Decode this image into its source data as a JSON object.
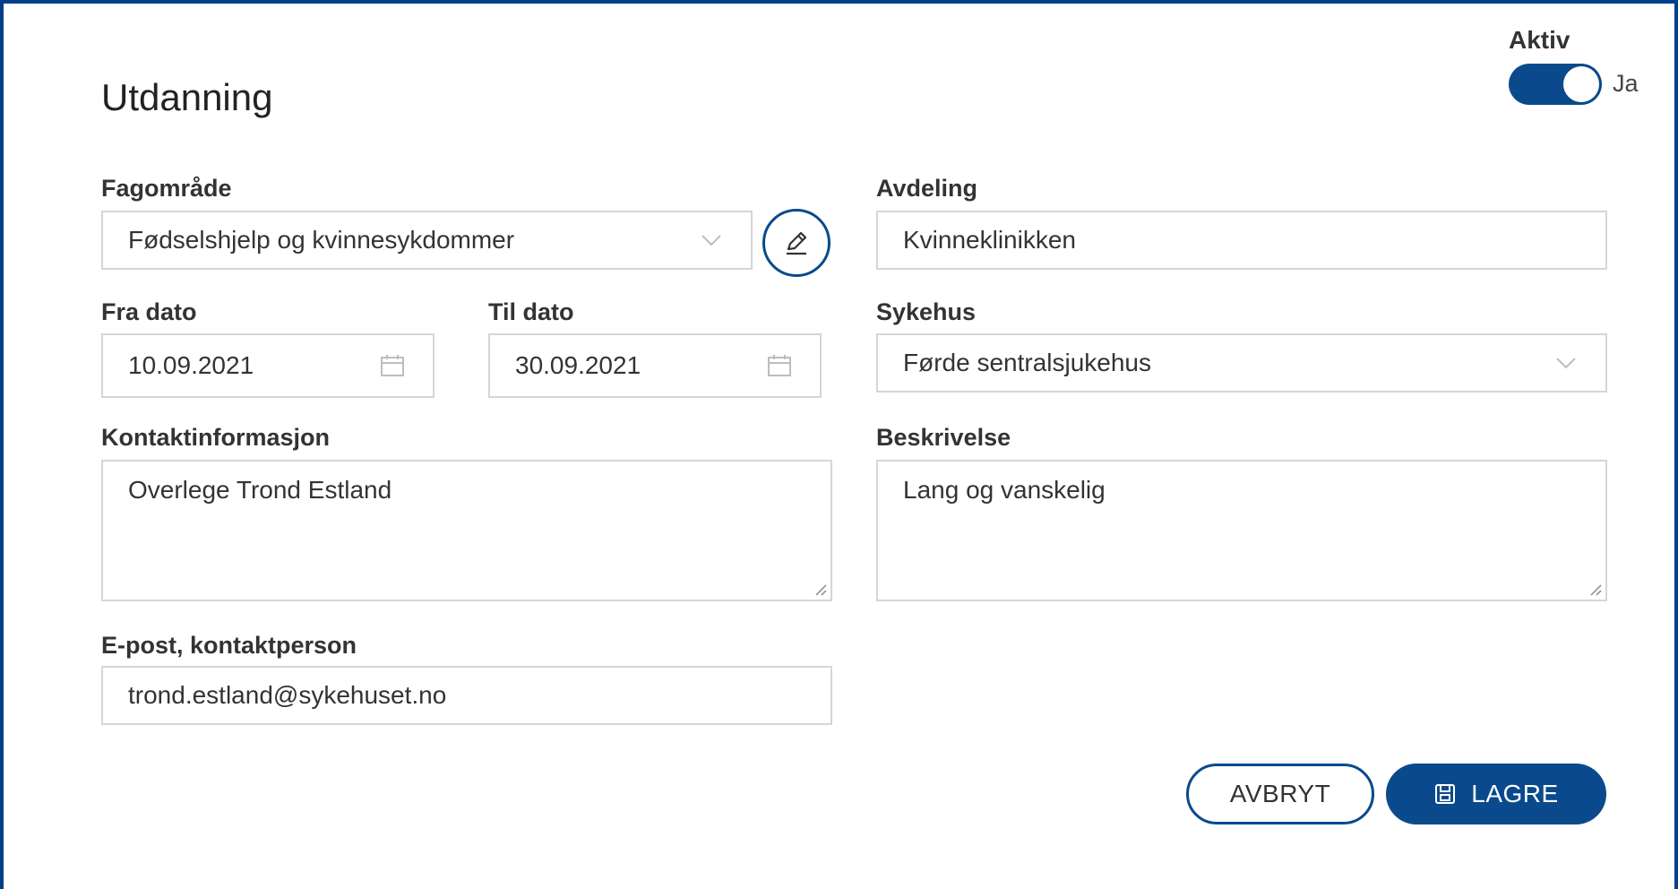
{
  "title": "Utdanning",
  "active_toggle": {
    "label": "Aktiv",
    "state_text": "Ja",
    "on": true
  },
  "fields": {
    "fagomrade": {
      "label": "Fagområde",
      "value": "Fødselshjelp og kvinnesykdommer"
    },
    "avdeling": {
      "label": "Avdeling",
      "value": "Kvinneklinikken"
    },
    "fra_dato": {
      "label": "Fra dato",
      "value": "10.09.2021"
    },
    "til_dato": {
      "label": "Til dato",
      "value": "30.09.2021"
    },
    "sykehus": {
      "label": "Sykehus",
      "value": "Førde sentralsjukehus"
    },
    "kontaktinformasjon": {
      "label": "Kontaktinformasjon",
      "value": "Overlege Trond Estland"
    },
    "beskrivelse": {
      "label": "Beskrivelse",
      "value": "Lang og vanskelig"
    },
    "epost": {
      "label": "E-post, kontaktperson",
      "value": "trond.estland@sykehuset.no"
    }
  },
  "buttons": {
    "cancel": "AVBRYT",
    "save": "LAGRE"
  },
  "icons": {
    "edit": "pencil-icon",
    "dropdown": "chevron-down-icon",
    "calendar": "calendar-icon",
    "save": "floppy-disk-icon"
  },
  "colors": {
    "primary": "#0a4a8c",
    "border": "#d6d6d6",
    "frame": "#003f87"
  }
}
